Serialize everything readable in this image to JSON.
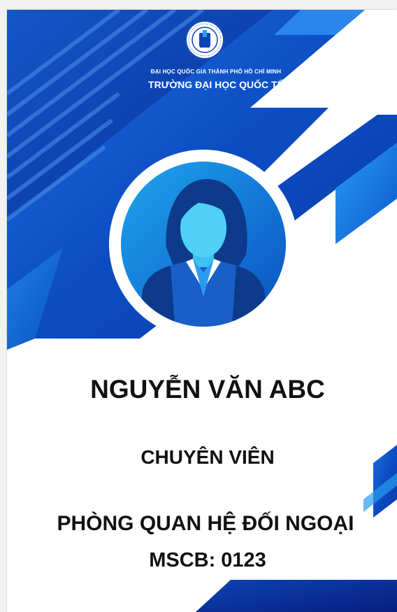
{
  "university": {
    "parent_name": "ĐẠI HỌC QUỐC GIA THÀNH PHỐ HỒ CHÍ MINH",
    "name": "TRƯỜNG ĐẠI HỌC QUỐC TẾ",
    "logo_text": "INTERNATIONAL UNIVERSITY - HCM CITY"
  },
  "person": {
    "full_name": "NGUYỄN VĂN ABC",
    "position": "CHUYÊN VIÊN",
    "department": "PHÒNG QUAN HỆ ĐỐI NGOẠI",
    "staff_id": "MSCB: 0123"
  },
  "icons": {
    "logo": "university-seal-icon",
    "avatar": "female-user-avatar-icon"
  },
  "colors": {
    "primary_blue": "#0a4fc4",
    "dark_blue": "#0b2f94",
    "light_blue": "#1e8fe8",
    "text": "#111111"
  }
}
